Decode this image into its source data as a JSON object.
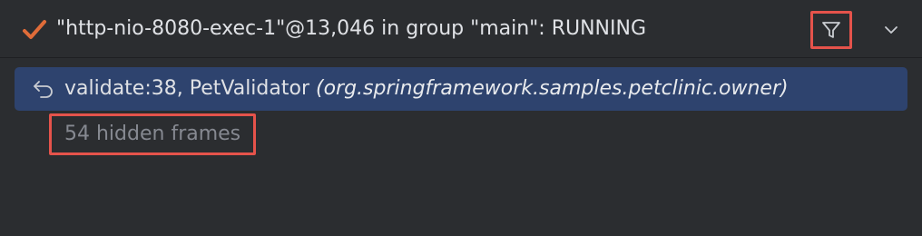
{
  "header": {
    "check_icon": "checkmark-icon",
    "thread_title": "\"http-nio-8080-exec-1\"@13,046 in group \"main\": RUNNING",
    "filter_icon": "filter-icon",
    "expand_icon": "chevron-down-icon"
  },
  "frames": {
    "selected": {
      "icon": "return-arrow-icon",
      "method": "validate:38, PetValidator ",
      "package": "(org.springframework.samples.petclinic.owner)"
    },
    "hidden_label": "54 hidden frames"
  },
  "colors": {
    "background": "#2b2d30",
    "selection": "#2e436e",
    "highlight_border": "#e5534b",
    "check": "#e06c39",
    "muted_text": "#868991"
  }
}
